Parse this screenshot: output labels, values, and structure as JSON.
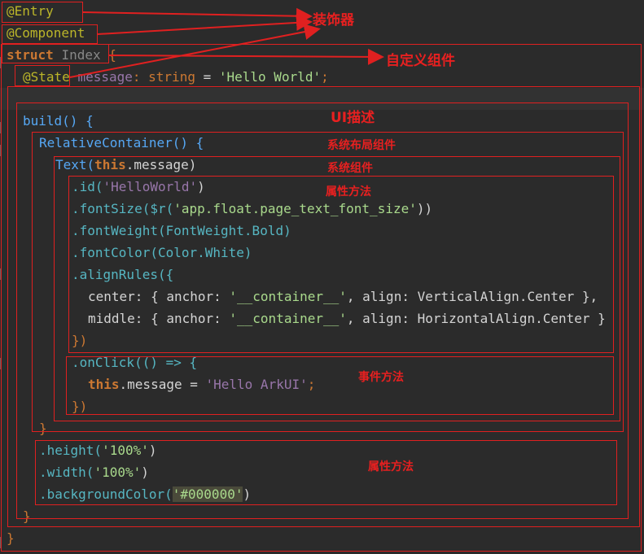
{
  "code": {
    "line1": "@Entry",
    "line2": "@Component",
    "line3_kw": "struct",
    "line3_name": "Index",
    "line3_brace": "{",
    "line4_ann": "@State",
    "line4_var": "message",
    "line4_colon": ":",
    "line4_type": "string",
    "line4_eq": "=",
    "line4_str": "'Hello World'",
    "line4_end": ";",
    "build": "build() {",
    "relative": "RelativeContainer() {",
    "text_fn": "Text(",
    "text_this": "this",
    "text_rest": ".message)",
    "id_line": ".id(",
    "id_str": "'HelloWorld'",
    "id_end": ")",
    "fontsize_pre": ".fontSize($r(",
    "fontsize_str": "'app.float.page_text_font_size'",
    "fontsize_end": "))",
    "fontweight": ".fontWeight(FontWeight.Bold)",
    "fontcolor": ".fontColor(Color.White)",
    "alignrules": ".alignRules({",
    "center_pre": "center: { anchor: ",
    "center_str": "'__container__'",
    "center_post": ", align: VerticalAlign.Center },",
    "middle_pre": "middle: { anchor: ",
    "middle_str": "'__container__'",
    "middle_post": ", align: HorizontalAlign.Center }",
    "close_align": "})",
    "onclick": ".onClick(() => {",
    "this_msg_kw": "this",
    "this_msg_mid": ".message = ",
    "this_msg_str": "'Hello ArkUI'",
    "this_msg_end": ";",
    "close_onclick": "})",
    "close_rel": "}",
    "height_pre": ".height(",
    "height_str": "'100%'",
    "height_end": ")",
    "width_pre": ".width(",
    "width_str": "'100%'",
    "width_end": ")",
    "bg_pre": ".backgroundColor(",
    "bg_str": "'#000000'",
    "bg_end": ")",
    "close_build": "}",
    "close_struct": "}"
  },
  "labels": {
    "decorator": "装饰器",
    "custom_component": "自定义组件",
    "ui_desc": "UI描述",
    "system_layout": "系统布局组件",
    "system_component": "系统组件",
    "attr_method_1": "属性方法",
    "event_method": "事件方法",
    "attr_method_2": "属性方法"
  },
  "colors": {
    "annotation": "#e02020",
    "background": "#2b2b2b"
  }
}
